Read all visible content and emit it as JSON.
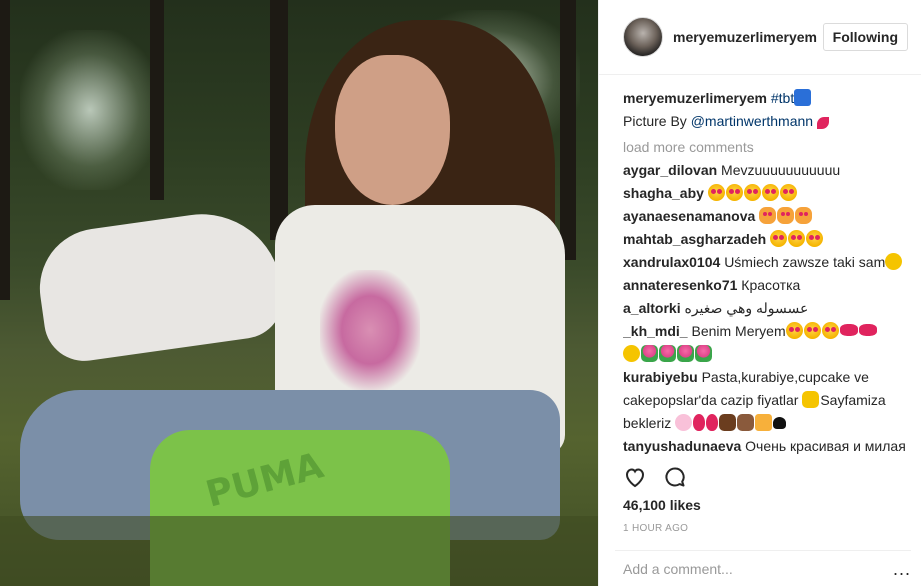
{
  "post": {
    "username": "meryemuzerlimeryem",
    "follow_label": "Following"
  },
  "caption": {
    "username": "meryemuzerlimeryem",
    "hashtag": "#tbt",
    "line2_prefix": "Picture By ",
    "mention": "@martinwerthmann"
  },
  "comments_panel": {
    "load_more": "load more comments",
    "comments": [
      {
        "user": "aygar_dilovan",
        "text": "Mevzuuuuuuuuuuu"
      },
      {
        "user": "shagha_aby",
        "text": ""
      },
      {
        "user": "ayanaesenamanova",
        "text": ""
      },
      {
        "user": "mahtab_asgharzadeh",
        "text": ""
      },
      {
        "user": "xandrulax0104",
        "text": "Uśmiech zawsze taki sam"
      },
      {
        "user": "annateresenko71",
        "text": "Красотка"
      },
      {
        "user": "a_altorki",
        "text": "عسسوله وهي صغيره"
      },
      {
        "user": "_kh_mdi_",
        "text": "Benim Meryem"
      },
      {
        "user": "kurabiyebu",
        "text": "Pasta,kurabiye,cupcake ve cakepopslar'da cazip fiyatlar",
        "text2": "Sayfamiza bekleriz"
      },
      {
        "user": "tanyushadunaeva",
        "text": "Очень красивая и милая девочка!"
      }
    ]
  },
  "actions": {
    "like_icon": "heart-outline-icon",
    "comment_icon": "speech-bubble-icon"
  },
  "likes": "46,100 likes",
  "time": "1 HOUR AGO",
  "add_comment": {
    "placeholder": "Add a comment...",
    "more": "..."
  },
  "photo": {
    "bag_text": "PUMA"
  }
}
